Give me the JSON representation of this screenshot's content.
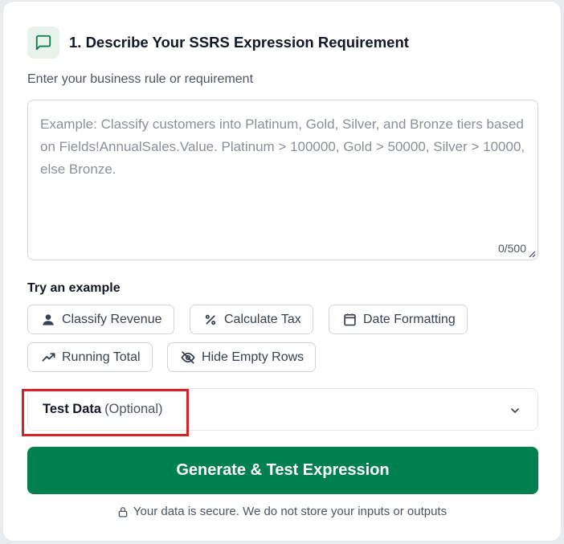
{
  "header": {
    "title": "1. Describe Your SSRS Expression Requirement",
    "icon": "message-square-icon",
    "icon_color": "#0f7a4b"
  },
  "requirement": {
    "label": "Enter your business rule or requirement",
    "value": "",
    "placeholder": "Example: Classify customers into Platinum, Gold, Silver, and Bronze tiers based on Fields!AnnualSales.Value. Platinum > 100000, Gold > 50000, Silver > 10000, else Bronze.",
    "char_count": "0/500"
  },
  "examples": {
    "title": "Try an example",
    "chips": [
      {
        "label": "Classify Revenue",
        "icon": "user-icon"
      },
      {
        "label": "Calculate Tax",
        "icon": "percent-icon"
      },
      {
        "label": "Date Formatting",
        "icon": "calendar-icon"
      },
      {
        "label": "Running Total",
        "icon": "trending-up-icon"
      },
      {
        "label": "Hide Empty Rows",
        "icon": "eye-off-icon"
      }
    ]
  },
  "test_data": {
    "title": "Test Data",
    "optional": "(Optional)",
    "expanded": false
  },
  "generate_button": {
    "label": "Generate & Test Expression",
    "color": "#007f4f"
  },
  "security_note": "Your data is secure. We do not store your inputs or outputs",
  "highlight_color": "#d92128"
}
